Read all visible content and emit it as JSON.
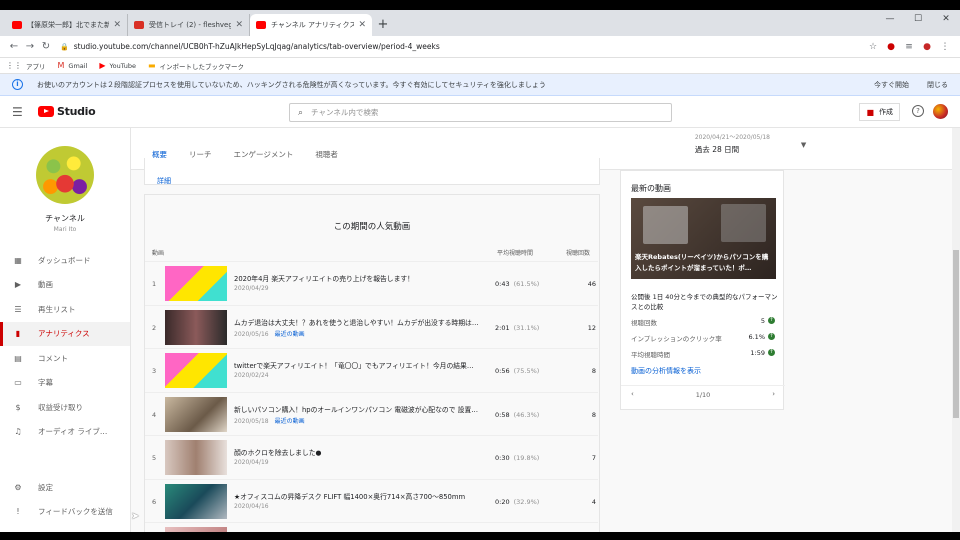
{
  "browser": {
    "tabs": [
      {
        "title": "【篠原栄一郎】北でまた新たな動き！",
        "active": false,
        "icon": "youtube-favicon",
        "color": "#ff0000"
      },
      {
        "title": "受信トレイ (2) - fleshvegetables@",
        "active": false,
        "icon": "gmail-favicon",
        "color": "#d93025"
      },
      {
        "title": "チャンネル アナリティクス - YouTube",
        "active": true,
        "icon": "youtube-favicon",
        "color": "#ff0000"
      }
    ],
    "url": "studio.youtube.com/channel/UCB0hT-hZuAJkHepSyLqJqag/analytics/tab-overview/period-4_weeks",
    "bookmarks": [
      {
        "label": "アプリ",
        "icon": "apps-grid-icon"
      },
      {
        "label": "Gmail",
        "icon": "gmail-icon"
      },
      {
        "label": "YouTube",
        "icon": "youtube-icon"
      },
      {
        "label": "インポートしたブックマーク",
        "icon": "folder-icon"
      }
    ]
  },
  "infobar": {
    "message": "お使いのアカウントは２段階認証プロセスを使用していないため、ハッキングされる危険性が高くなっています。今すぐ有効にしてセキュリティを強化しましょう",
    "start_label": "今すぐ開始",
    "close_label": "閉じる"
  },
  "header": {
    "logo_text": "Studio",
    "search_placeholder": "チャンネル内で検索",
    "create_label": "作成",
    "help_glyph": "?"
  },
  "sidebar": {
    "channel_name": "チャンネル",
    "channel_sub": "Mari Ito",
    "items": [
      {
        "label": "ダッシュボード",
        "icon": "dashboard-icon",
        "glyph": "▦",
        "active": false
      },
      {
        "label": "動画",
        "icon": "video-icon",
        "glyph": "▶",
        "active": false
      },
      {
        "label": "再生リスト",
        "icon": "playlist-icon",
        "glyph": "☰",
        "active": false
      },
      {
        "label": "アナリティクス",
        "icon": "analytics-icon",
        "glyph": "▮",
        "active": true
      },
      {
        "label": "コメント",
        "icon": "comment-icon",
        "glyph": "▤",
        "active": false
      },
      {
        "label": "字幕",
        "icon": "subtitles-icon",
        "glyph": "▭",
        "active": false
      },
      {
        "label": "収益受け取り",
        "icon": "dollar-icon",
        "glyph": "$",
        "active": false
      },
      {
        "label": "オーディオ ライブ…",
        "icon": "audio-library-icon",
        "glyph": "♫",
        "active": false
      }
    ],
    "bottom_items": [
      {
        "label": "設定",
        "icon": "settings-icon",
        "glyph": "⚙"
      },
      {
        "label": "フィードバックを送信",
        "icon": "feedback-icon",
        "glyph": "!"
      }
    ]
  },
  "subtabs": [
    {
      "label": "概要",
      "active": true
    },
    {
      "label": "リーチ",
      "active": false
    },
    {
      "label": "エンゲージメント",
      "active": false
    },
    {
      "label": "視聴者",
      "active": false
    }
  ],
  "date": {
    "range": "2020/04/21～2020/05/18",
    "value": "過去 28 日間"
  },
  "top_card": {
    "detail_label": "詳細"
  },
  "popular": {
    "title": "この期間の人気動画",
    "col_video": "動画",
    "col_duration": "平均視聴時間",
    "col_views": "視聴回数",
    "rows": [
      {
        "rank": "1",
        "title": "2020年4月 楽天アフィリエイトの売り上げを報告します！",
        "date": "2020/04/29",
        "popular": "",
        "duration": "0:43",
        "pct": "(61.5%)",
        "views": "46",
        "thumb": "linear-gradient(135deg,#ff66c4 0 40%,#ffe600 40% 70%,#40e0d0 70%)"
      },
      {
        "rank": "2",
        "title": "ムカデ退治は大丈夫！？あれを使うと退治しやすい！ムカデが出没する時期は…",
        "date": "2020/05/16",
        "popular": "最近の動画",
        "duration": "2:01",
        "pct": "(31.1%)",
        "views": "12",
        "thumb": "linear-gradient(90deg,#3a2a2a,#8b5a5a 50%,#2a2a2a)"
      },
      {
        "rank": "3",
        "title": "twitterで楽天アフィリエイト！「竜〇〇」でもアフィリエイト！今月の結果はこ…",
        "date": "2020/02/24",
        "popular": "",
        "duration": "0:56",
        "pct": "(75.5%)",
        "views": "8",
        "thumb": "linear-gradient(135deg,#ff66c4 0 35%,#ffe600 35% 65%,#40e0d0 65%)"
      },
      {
        "rank": "4",
        "title": "新しいパソコン購入！hpのオールインワンパソコン 電磁波が心配なので 設置す…",
        "date": "2020/05/18",
        "popular": "最近の動画",
        "duration": "0:58",
        "pct": "(46.3%)",
        "views": "8",
        "thumb": "linear-gradient(135deg,#c9b8a0,#6b5a48 60%,#e0d6c8)"
      },
      {
        "rank": "5",
        "title": "顔のホクロを除去しました●",
        "date": "2020/04/19",
        "popular": "",
        "duration": "0:30",
        "pct": "(19.8%)",
        "views": "7",
        "thumb": "linear-gradient(90deg,#d8c8c0,#a08070 50%,#e8e0dc)"
      },
      {
        "rank": "6",
        "title": "★オフィスコムの昇降デスク FLIFT 幅1400×奥行714×高さ700～850mm",
        "date": "2020/04/16",
        "popular": "",
        "duration": "0:20",
        "pct": "(32.9%)",
        "views": "4",
        "thumb": "linear-gradient(135deg,#2a8a7a,#1a4a5a 50%,#b0b8c0)"
      }
    ]
  },
  "latest": {
    "title": "最新の動画",
    "overlay": "楽天Rebates(リーベイツ)からパソコンを購入したらポイントが溜まっていた！ポ…",
    "desc": "公開後 1日 40分と今までの典型的なパフォーマンスとの比較",
    "stats": [
      {
        "label": "視聴回数",
        "value": "5"
      },
      {
        "label": "インプレッションのクリック率",
        "value": "6.1%"
      },
      {
        "label": "平均視聴時間",
        "value": "1:59"
      }
    ],
    "link": "動画の分析情報を表示",
    "pager": "1/10"
  },
  "colors": {
    "accent_red": "#cc0000",
    "link_blue": "#065fd4",
    "good_green": "#2e7d32"
  }
}
